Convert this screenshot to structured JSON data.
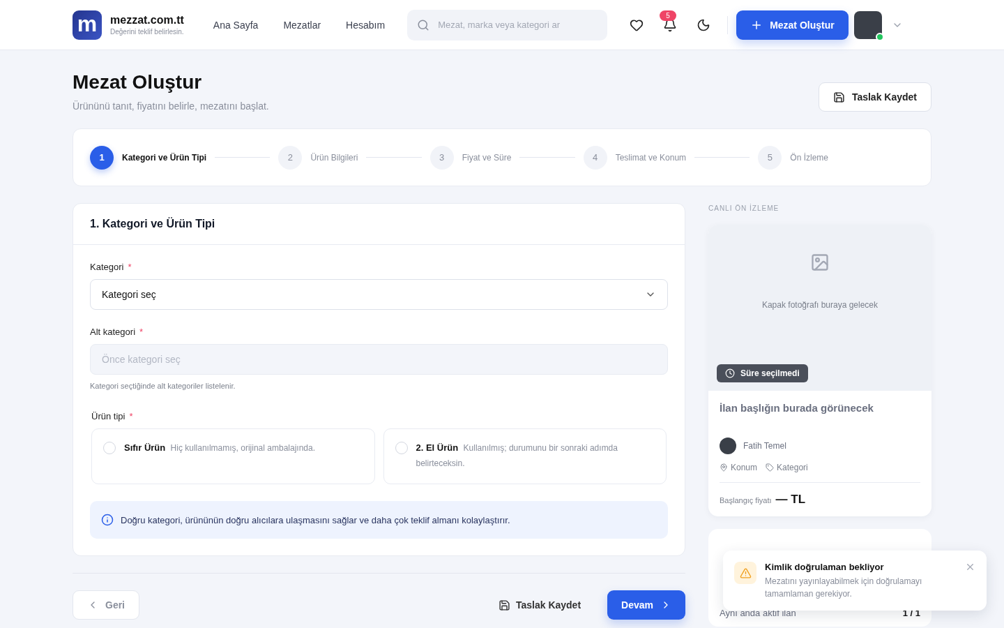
{
  "header": {
    "logo_letter": "m",
    "brand": "mezzat.com.tt",
    "tagline": "Değerini teklif belirlesin.",
    "nav": [
      {
        "label": "Ana Sayfa",
        "selected": false
      },
      {
        "label": "Mezatlar",
        "selected": false
      },
      {
        "label": "Hesabım",
        "selected": false
      }
    ],
    "search": {
      "placeholder": "Mezat, marka veya kategori ar"
    },
    "notifications": "5",
    "create_button": "Mezat Oluştur",
    "user_online": true
  },
  "page": {
    "title": "Mezat Oluştur",
    "subtitle": "Ürününü tanıt, fiyatını belirle, mezatını başlat.",
    "draft_button": "Taslak Kaydet"
  },
  "steps": [
    {
      "number": "1",
      "label": "Kategori ve Ürün Tipi",
      "selected": true
    },
    {
      "number": "2",
      "label": "Ürün Bilgileri",
      "selected": false
    },
    {
      "number": "3",
      "label": "Fiyat ve Süre",
      "selected": false
    },
    {
      "number": "4",
      "label": "Teslimat ve Konum",
      "selected": false
    },
    {
      "number": "5",
      "label": "Ön İzleme",
      "selected": false
    }
  ],
  "form": {
    "title": "1. Kategori ve Ürün Tipi",
    "category": {
      "label": "Kategori",
      "required_mark": "*",
      "value": "Kategori seç"
    },
    "subcategory": {
      "label": "Alt kategori",
      "required_mark": "*",
      "placeholder": "Önce kategori seç",
      "disabled": true,
      "hint": "Kategori seçtiğinde alt kategoriler listelenir."
    },
    "product_type": {
      "label": "Ürün tipi",
      "required_mark": "*",
      "options": [
        {
          "title": "Sıfır Ürün",
          "description": "Hiç kullanılmamış, orijinal ambalajında.",
          "selected": false
        },
        {
          "title": "2. El Ürün",
          "description": "Kullanılmış; durumunu bir sonraki adımda belirteceksin.",
          "selected": false
        }
      ]
    },
    "info": "Doğru kategori, ürününün doğru alıcılara ulaşmasını sağlar ve daha çok teklif almanı kolaylaştırır."
  },
  "footer": {
    "back": "Geri",
    "draft": "Taslak Kaydet",
    "next": "Devam"
  },
  "preview": {
    "heading": "CANLI ÖN İZLEME",
    "cover_text": "Kapak fotoğrafı buraya gelecek",
    "duration_badge": "Süre seçilmedi",
    "listing_title": "İlan başlığın burada görünecek",
    "seller": "Fatih Temel",
    "location": "Konum",
    "category": "Kategori",
    "price_label": "Başlangıç fiyatı",
    "price_value": "— TL"
  },
  "limits": {
    "label": "Aynı anda aktif ilan",
    "value": "1 / 1"
  },
  "toast": {
    "title": "Kimlik doğrulaman bekliyor",
    "message": "Mezatını yayınlayabilmek için doğrulamayı tamamlaman gerekiyor."
  }
}
